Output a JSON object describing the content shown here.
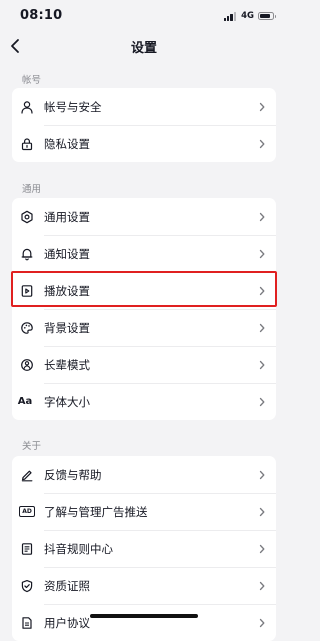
{
  "status_bar": {
    "time": "08:10",
    "network": "4G",
    "battery_level": 0.85
  },
  "nav": {
    "title": "设置"
  },
  "sections": {
    "account": {
      "label": "帐号",
      "items": [
        {
          "label": "帐号与安全",
          "icon": "person-icon"
        },
        {
          "label": "隐私设置",
          "icon": "lock-icon"
        }
      ]
    },
    "general": {
      "label": "通用",
      "items": [
        {
          "label": "通用设置",
          "icon": "gear-icon"
        },
        {
          "label": "通知设置",
          "icon": "bell-icon"
        },
        {
          "label": "播放设置",
          "icon": "play-icon"
        },
        {
          "label": "背景设置",
          "icon": "palette-icon"
        },
        {
          "label": "长辈模式",
          "icon": "elder-mode-icon"
        },
        {
          "label": "字体大小",
          "icon": "font-size-icon",
          "icon_text": "Aa"
        }
      ]
    },
    "about": {
      "label": "关于",
      "items": [
        {
          "label": "反馈与帮助",
          "icon": "edit-icon"
        },
        {
          "label": "了解与管理广告推送",
          "icon": "ad-icon",
          "icon_text": "AD"
        },
        {
          "label": "抖音规则中心",
          "icon": "rules-icon"
        },
        {
          "label": "资质证照",
          "icon": "shield-check-icon"
        },
        {
          "label": "用户协议",
          "icon": "document-icon"
        }
      ]
    }
  },
  "colors": {
    "background": "#f3f3f5",
    "card": "#ffffff",
    "highlight": "#e02020",
    "text_primary": "#161823",
    "text_secondary": "#8a8b91"
  }
}
